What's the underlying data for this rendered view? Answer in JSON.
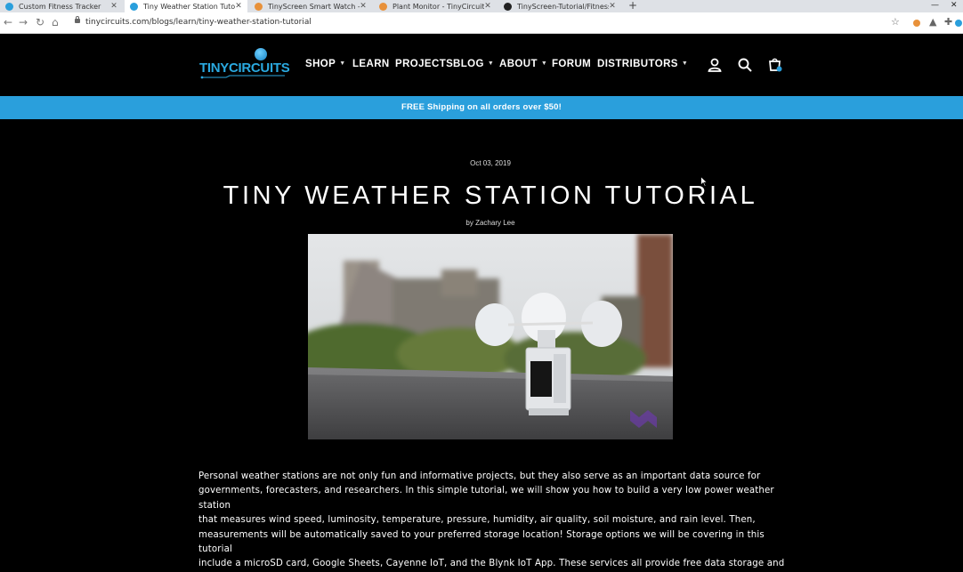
{
  "browser": {
    "tabs": [
      {
        "title": "Custom Fitness Tracker",
        "favicon_color": "#2a9fdc",
        "active": false
      },
      {
        "title": "Tiny Weather Station Tutorial",
        "favicon_color": "#2a9fdc",
        "active": true
      },
      {
        "title": "TinyScreen Smart Watch - TinyCi",
        "favicon_color": "#e8913a",
        "active": false
      },
      {
        "title": "Plant Monitor - TinyCircuits",
        "favicon_color": "#e8913a",
        "active": false
      },
      {
        "title": "TinyScreen-Tutorial/FitnessTrack",
        "favicon_color": "#222222",
        "active": false
      }
    ],
    "new_tab_icon": "plus-icon",
    "url": "tinycircuits.com/blogs/learn/tiny-weather-station-tutorial"
  },
  "site": {
    "logo_text": "TINYCIRCUITS",
    "nav": [
      {
        "label": "SHOP",
        "has_dropdown": true
      },
      {
        "label": "LEARN",
        "has_dropdown": false
      },
      {
        "label": "PROJECTS",
        "has_dropdown": false
      },
      {
        "label": "BLOG",
        "has_dropdown": true
      },
      {
        "label": "ABOUT",
        "has_dropdown": true
      },
      {
        "label": "FORUM",
        "has_dropdown": false
      },
      {
        "label": "DISTRIBUTORS",
        "has_dropdown": true
      }
    ],
    "header_icons": [
      "account-icon",
      "search-icon",
      "cart-icon"
    ],
    "announcement": "FREE Shipping on all orders over $50!",
    "accent_color": "#2a9fdc"
  },
  "article": {
    "date": "Oct 03, 2019",
    "title": "TINY WEATHER STATION TUTORIAL",
    "author": "by Zachary Lee",
    "body_lines": [
      "Personal weather stations are not only fun and informative projects, but they also serve as an important data source for",
      "governments, forecasters, and researchers. In this simple tutorial, we will show you how to build a very low power weather station",
      "that measures wind speed, luminosity, temperature, pressure, humidity, air quality, soil moisture, and rain level. Then,",
      "measurements will be automatically saved to your preferred storage location! Storage options we will be covering in this tutorial",
      "include a microSD card, Google Sheets, Cayenne IoT, and the Blynk IoT App. These services all provide free data storage and"
    ]
  }
}
